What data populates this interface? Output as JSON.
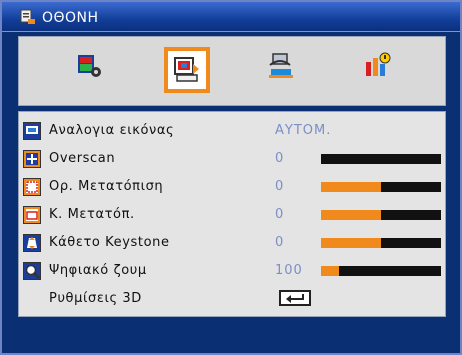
{
  "window": {
    "title": "ΟΘΟΝΗ"
  },
  "tabs": [
    {
      "icon": "image-settings-icon",
      "selected": false
    },
    {
      "icon": "display-settings-icon",
      "selected": true
    },
    {
      "icon": "system-settings-icon",
      "selected": false
    },
    {
      "icon": "info-options-icon",
      "selected": false
    }
  ],
  "menu": {
    "items": [
      {
        "label": "Αναλογια εικόνας",
        "value": "ΑΥΤΟΜ.",
        "icon": "aspect-ratio-icon"
      },
      {
        "label": "Overscan",
        "value": "0",
        "level": 0,
        "icon": "overscan-icon"
      },
      {
        "label": "Ορ. Μετατόπιση",
        "value": "0",
        "level": 0.5,
        "icon": "h-shift-icon"
      },
      {
        "label": "Κ. Μετατόπ.",
        "value": "0",
        "level": 0.5,
        "icon": "v-shift-icon"
      },
      {
        "label": "Κάθετο Keystone",
        "value": "0",
        "level": 0.5,
        "icon": "keystone-icon"
      },
      {
        "label": "Ψηφιακό ζουμ",
        "value": "100",
        "level": 0.15,
        "icon": "digital-zoom-icon"
      },
      {
        "label": "Ρυθμίσεις 3D",
        "icon": "enter-key-icon"
      }
    ]
  },
  "colors": {
    "accent": "#f08a1c",
    "background": "#0a2f73",
    "value_text": "#7a8fc8"
  }
}
